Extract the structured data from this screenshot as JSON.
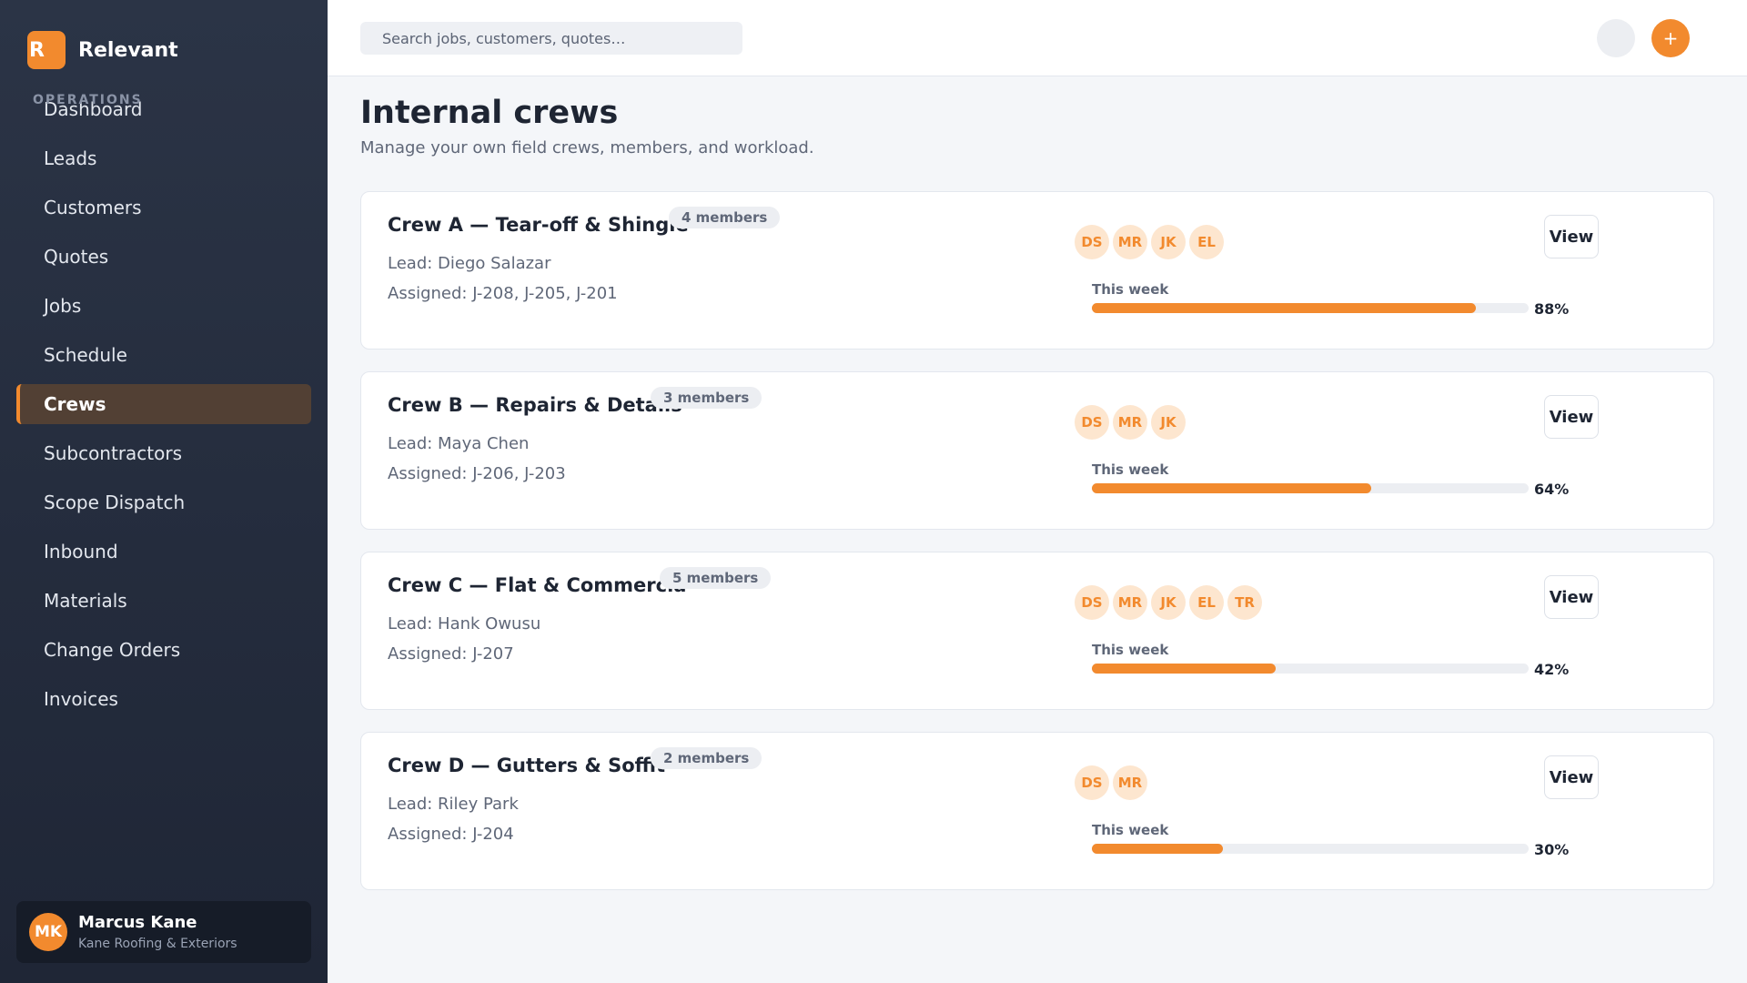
{
  "brand": {
    "logo_letter": "R",
    "name": "Relevant"
  },
  "sidebar": {
    "section_label": "OPERATIONS",
    "items": [
      {
        "label": "Dashboard",
        "active": false
      },
      {
        "label": "Leads",
        "active": false
      },
      {
        "label": "Customers",
        "active": false
      },
      {
        "label": "Quotes",
        "active": false
      },
      {
        "label": "Jobs",
        "active": false
      },
      {
        "label": "Schedule",
        "active": false
      },
      {
        "label": "Crews",
        "active": true
      },
      {
        "label": "Subcontractors",
        "active": false
      },
      {
        "label": "Scope Dispatch",
        "active": false
      },
      {
        "label": "Inbound",
        "active": false
      },
      {
        "label": "Materials",
        "active": false
      },
      {
        "label": "Change Orders",
        "active": false
      },
      {
        "label": "Invoices",
        "active": false
      }
    ],
    "user": {
      "initials": "MK",
      "name": "Marcus Kane",
      "company": "Kane Roofing & Exteriors"
    }
  },
  "topbar": {
    "search_placeholder": "Search jobs, customers, quotes…",
    "add_label": "+"
  },
  "page": {
    "title": "Internal crews",
    "subtitle": "Manage your own field crews, members, and workload."
  },
  "crews": [
    {
      "name": "Crew A — Tear-off & Shingle",
      "members": "4 members",
      "lead": "Lead: Diego Salazar",
      "assigned": "Assigned: J-208, J-205, J-201",
      "avatars": [
        "DS",
        "MR",
        "JK",
        "EL"
      ],
      "week_label": "This week",
      "progress": 0.88,
      "progress_label": "88%",
      "view_label": "View"
    },
    {
      "name": "Crew B — Repairs & Details",
      "members": "3 members",
      "lead": "Lead: Maya Chen",
      "assigned": "Assigned: J-206, J-203",
      "avatars": [
        "DS",
        "MR",
        "JK"
      ],
      "week_label": "This week",
      "progress": 0.64,
      "progress_label": "64%",
      "view_label": "View"
    },
    {
      "name": "Crew C — Flat & Commercial",
      "members": "5 members",
      "lead": "Lead: Hank Owusu",
      "assigned": "Assigned: J-207",
      "avatars": [
        "DS",
        "MR",
        "JK",
        "EL",
        "TR"
      ],
      "week_label": "This week",
      "progress": 0.42,
      "progress_label": "42%",
      "view_label": "View"
    },
    {
      "name": "Crew D — Gutters & Soffit",
      "members": "2 members",
      "lead": "Lead: Riley Park",
      "assigned": "Assigned: J-204",
      "avatars": [
        "DS",
        "MR"
      ],
      "week_label": "This week",
      "progress": 0.3,
      "progress_label": "30%",
      "view_label": "View"
    }
  ],
  "colors": {
    "accent": "#f28a2e",
    "sidebar_bg": "#2b3446",
    "avatar_bg": "#fde6cf"
  }
}
